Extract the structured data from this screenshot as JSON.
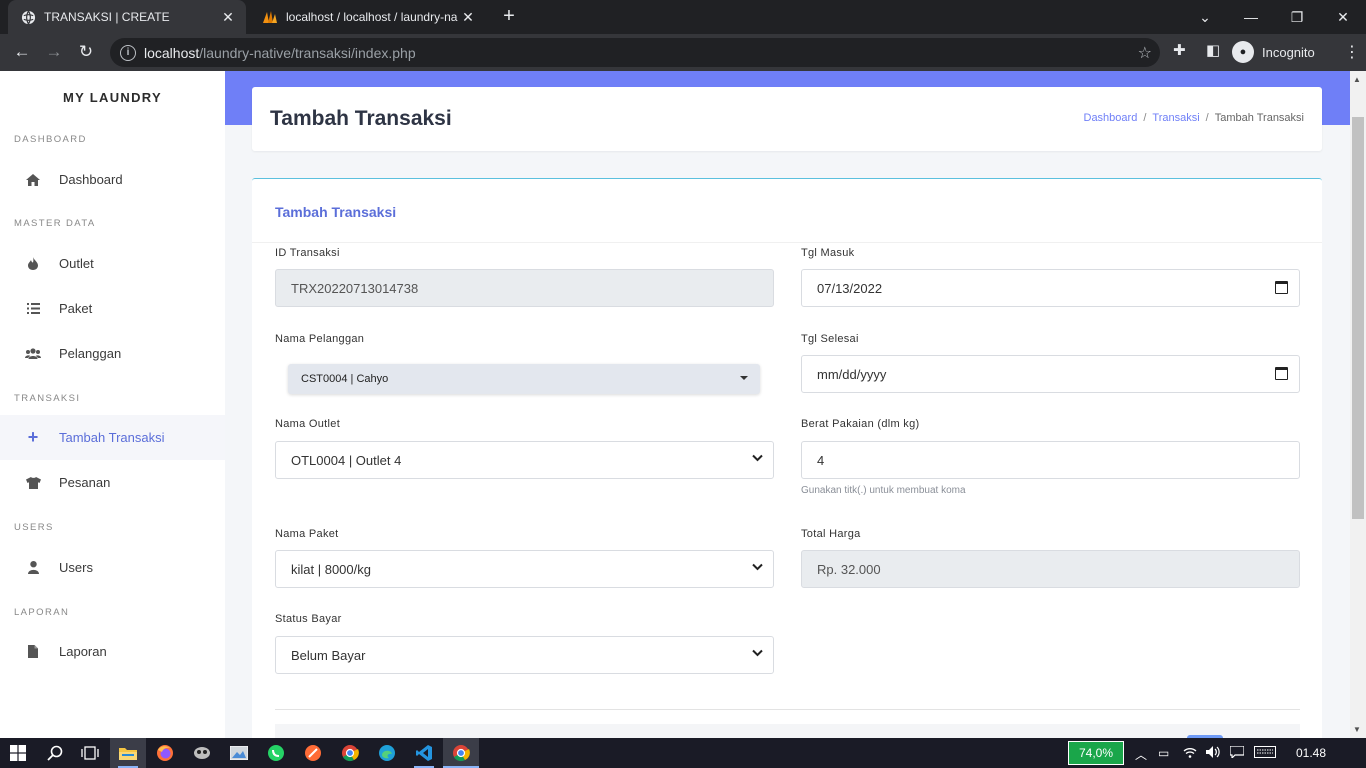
{
  "browser": {
    "tabs": [
      {
        "title": "TRANSAKSI | CREATE",
        "active": true
      },
      {
        "title": "localhost / localhost / laundry-na",
        "active": false
      }
    ],
    "url_host": "localhost",
    "url_path": "/laundry-native/transaksi/index.php",
    "profile": "Incognito"
  },
  "sidebar": {
    "brand": "MY LAUNDRY",
    "sections": [
      {
        "heading": "DASHBOARD",
        "items": [
          {
            "label": "Dashboard",
            "icon": "home-icon"
          }
        ]
      },
      {
        "heading": "MASTER DATA",
        "items": [
          {
            "label": "Outlet",
            "icon": "fire-icon"
          },
          {
            "label": "Paket",
            "icon": "list-icon"
          },
          {
            "label": "Pelanggan",
            "icon": "users-icon"
          }
        ]
      },
      {
        "heading": "TRANSAKSI",
        "items": [
          {
            "label": "Tambah Transaksi",
            "icon": "plus-icon",
            "active": true
          },
          {
            "label": "Pesanan",
            "icon": "shirt-icon"
          }
        ]
      },
      {
        "heading": "USERS",
        "items": [
          {
            "label": "Users",
            "icon": "user-icon"
          }
        ]
      },
      {
        "heading": "LAPORAN",
        "items": [
          {
            "label": "Laporan",
            "icon": "file-icon"
          }
        ]
      }
    ]
  },
  "header": {
    "title": "Tambah Transaksi",
    "breadcrumb": [
      "Dashboard",
      "Transaksi",
      "Tambah Transaksi"
    ],
    "separator": "/"
  },
  "form": {
    "card_title": "Tambah Transaksi",
    "id_transaksi": {
      "label": "ID Transaksi",
      "value": "TRX20220713014738"
    },
    "tgl_masuk": {
      "label": "Tgl Masuk",
      "value": "07/13/2022"
    },
    "nama_pelanggan": {
      "label": "Nama Pelanggan",
      "value": "CST0004 | Cahyo"
    },
    "tgl_selesai": {
      "label": "Tgl Selesai",
      "placeholder": "mm/dd/yyyy"
    },
    "nama_outlet": {
      "label": "Nama Outlet",
      "value": "OTL0004 | Outlet 4"
    },
    "berat": {
      "label": "Berat Pakaian (dlm kg)",
      "value": "4",
      "help": "Gunakan titk(.) untuk membuat koma"
    },
    "nama_paket": {
      "label": "Nama Paket",
      "value": "kilat | 8000/kg"
    },
    "total_harga": {
      "label": "Total Harga",
      "value": "Rp. 32.000"
    },
    "status_bayar": {
      "label": "Status Bayar",
      "value": "Belum Bayar"
    }
  },
  "taskbar": {
    "battery": "74,0%",
    "time": "01.48"
  },
  "colors": {
    "accent": "#6f7ff7",
    "card_border": "#5bc0de",
    "sidebar_active": "#5b6ed9"
  }
}
